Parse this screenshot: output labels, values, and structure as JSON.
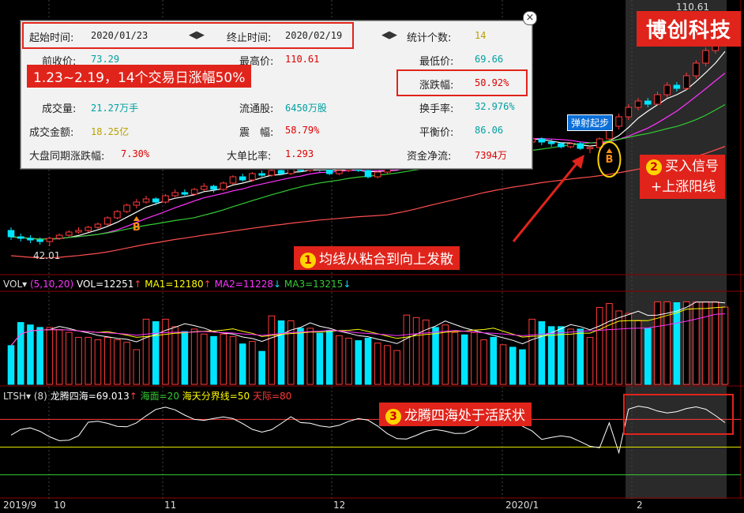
{
  "colors": {
    "up": "#ff3a3a",
    "down": "#00e5ff",
    "ma5": "#ffffff",
    "ma10": "#ff33ff",
    "ma20": "#33cc33",
    "ma60": "#ff4d4d",
    "yellow": "#e6e600",
    "brand": "#e0241b"
  },
  "brand": "博创科技",
  "panel": {
    "start_label": "起始时间:",
    "start_value": "2020/01/23",
    "end_label": "终止时间:",
    "end_value": "2020/02/19",
    "count_label": "统计个数:",
    "count_value": "14",
    "open_label": "前收价:",
    "open_value": "73.29",
    "high_label": "最高价:",
    "high_value": "110.61",
    "low_label": "最低价:",
    "low_value": "69.66",
    "change_label": "涨跌幅:",
    "change_value": "50.92%",
    "vol_label": "成交量:",
    "vol_value": "21.27万手",
    "float_label": "流通股:",
    "float_value": "6450万股",
    "turn_label": "换手率:",
    "turn_value": "32.976%",
    "amount_label": "成交金额:",
    "amount_value": "18.25亿",
    "amp_label": "震　幅:",
    "amp_value": "58.79%",
    "avg_label": "平衡价:",
    "avg_value": "86.06",
    "market_label": "大盘同期涨跌幅:",
    "market_value": "7.30%",
    "big_label": "大单比率:",
    "big_value": "1.293",
    "flow_label": "资金净流:",
    "flow_value": "7394万",
    "arrows_left": "◀▶",
    "arrows_right": "◀▶"
  },
  "annotations": {
    "a_summary": "1.23~2.19，14个交易日涨幅50%",
    "a1": "均线从粘合到向上发散",
    "a1_num": "1",
    "a2_line1": "买入信号",
    "a2_line2": "+上涨阳线",
    "a2_num": "2",
    "a3": "龙腾四海处于活跃状",
    "a3_num": "3",
    "tag": "弹射起步",
    "s_mark": "S",
    "b_mark": "B"
  },
  "main": {
    "high_label": "110.61",
    "low_label": "42.01"
  },
  "vol_header": {
    "name": "VOL",
    "params": "(5,10,20)",
    "vol": "VOL=12251",
    "ma1": "MA1=12180",
    "ma2": "MA2=11228",
    "ma3": "MA3=13215"
  },
  "ltsh_header": {
    "name": "LTSH",
    "params": "(8)",
    "main": "龙腾四海=69.013",
    "sea": "海面=20",
    "mid": "海天分界线=50",
    "sky": "天际=80"
  },
  "x_axis": [
    "2019/9",
    "10",
    "11",
    "12",
    "2020/1",
    "2"
  ],
  "chart_data": {
    "type": "candlestick",
    "price_range": [
      35,
      118
    ],
    "candles": [
      [
        47,
        45,
        48,
        44
      ],
      [
        45,
        44.5,
        46,
        43.5
      ],
      [
        44.5,
        44,
        45.5,
        43
      ],
      [
        44,
        43.5,
        44.8,
        42.5
      ],
      [
        43.5,
        44.5,
        45,
        42.01
      ],
      [
        44.5,
        45.5,
        46,
        44
      ],
      [
        45.5,
        46.5,
        47,
        45
      ],
      [
        46.5,
        47,
        48,
        46
      ],
      [
        47,
        48,
        48.5,
        46.5
      ],
      [
        48,
        49,
        49.5,
        47.5
      ],
      [
        49,
        51,
        51.5,
        48.5
      ],
      [
        51,
        53,
        53.5,
        50.5
      ],
      [
        53,
        55,
        55.5,
        52.5
      ],
      [
        55,
        56,
        57,
        54
      ],
      [
        56,
        57,
        58,
        55.5
      ],
      [
        57,
        56,
        57.5,
        55
      ],
      [
        56,
        58,
        58.5,
        55.5
      ],
      [
        58,
        59,
        60,
        57.5
      ],
      [
        59,
        58.5,
        60,
        58
      ],
      [
        58.5,
        60,
        60.5,
        58
      ],
      [
        60,
        61,
        62,
        59.5
      ],
      [
        61,
        60,
        61.5,
        59
      ],
      [
        60,
        62,
        62.5,
        59.5
      ],
      [
        62,
        64,
        64.5,
        61.5
      ],
      [
        64,
        63,
        65,
        62.5
      ],
      [
        63,
        65,
        65.5,
        62.5
      ],
      [
        65,
        64.5,
        66,
        64
      ],
      [
        64.5,
        66,
        66.5,
        64
      ],
      [
        66,
        65,
        67,
        64.5
      ],
      [
        65,
        66.5,
        67,
        64.5
      ],
      [
        66.5,
        66,
        67.5,
        65.5
      ],
      [
        66,
        67,
        68,
        65.5
      ],
      [
        67,
        66.5,
        67.5,
        65.5
      ],
      [
        66.5,
        65,
        67,
        64.5
      ],
      [
        65,
        66,
        66.5,
        64.5
      ],
      [
        66,
        67,
        67.5,
        65.5
      ],
      [
        67,
        66,
        68,
        65.5
      ],
      [
        66,
        64,
        66.5,
        63.5
      ],
      [
        64,
        65.5,
        66,
        63.5
      ],
      [
        65.5,
        67,
        67.5,
        65
      ],
      [
        67,
        68,
        68.5,
        66.5
      ],
      [
        68,
        70,
        70.5,
        67.5
      ],
      [
        70,
        72,
        72.5,
        69.5
      ],
      [
        72,
        74,
        74.5,
        71
      ],
      [
        74,
        73,
        75,
        72.5
      ],
      [
        73,
        75,
        76,
        72.5
      ],
      [
        75,
        76,
        77,
        74
      ],
      [
        76,
        75,
        77,
        74.5
      ],
      [
        75,
        77,
        77.5,
        74.5
      ],
      [
        77,
        78,
        79,
        76.5
      ],
      [
        78,
        76,
        78.5,
        75.5
      ],
      [
        76,
        77,
        77.5,
        75.5
      ],
      [
        77,
        76,
        78,
        75
      ],
      [
        76,
        75,
        77,
        74.5
      ],
      [
        75,
        76,
        76.5,
        74
      ],
      [
        76,
        75,
        76.5,
        74
      ],
      [
        75,
        74.5,
        76,
        73.5
      ],
      [
        74.5,
        73.5,
        75,
        73
      ],
      [
        73.5,
        74.5,
        75,
        73
      ],
      [
        74.5,
        73,
        75,
        72.5
      ],
      [
        73,
        73.3,
        74,
        71.5
      ],
      [
        73.3,
        76,
        76.5,
        72.5
      ],
      [
        76,
        80,
        81,
        75.5
      ],
      [
        80,
        83,
        84,
        79
      ],
      [
        83,
        86,
        87,
        82
      ],
      [
        86,
        88,
        89,
        85
      ],
      [
        88,
        87,
        89,
        86
      ],
      [
        87,
        90,
        91,
        86.5
      ],
      [
        90,
        93,
        94,
        89
      ],
      [
        93,
        92,
        94,
        91
      ],
      [
        92,
        96,
        97,
        91.5
      ],
      [
        96,
        100,
        101,
        95
      ],
      [
        100,
        104,
        105,
        99
      ],
      [
        104,
        108,
        109,
        103
      ],
      [
        108,
        110.61,
        110.61,
        107
      ]
    ],
    "series": [
      {
        "name": "MA1"
      },
      {
        "name": "MA2"
      },
      {
        "name": "MA3"
      }
    ]
  }
}
